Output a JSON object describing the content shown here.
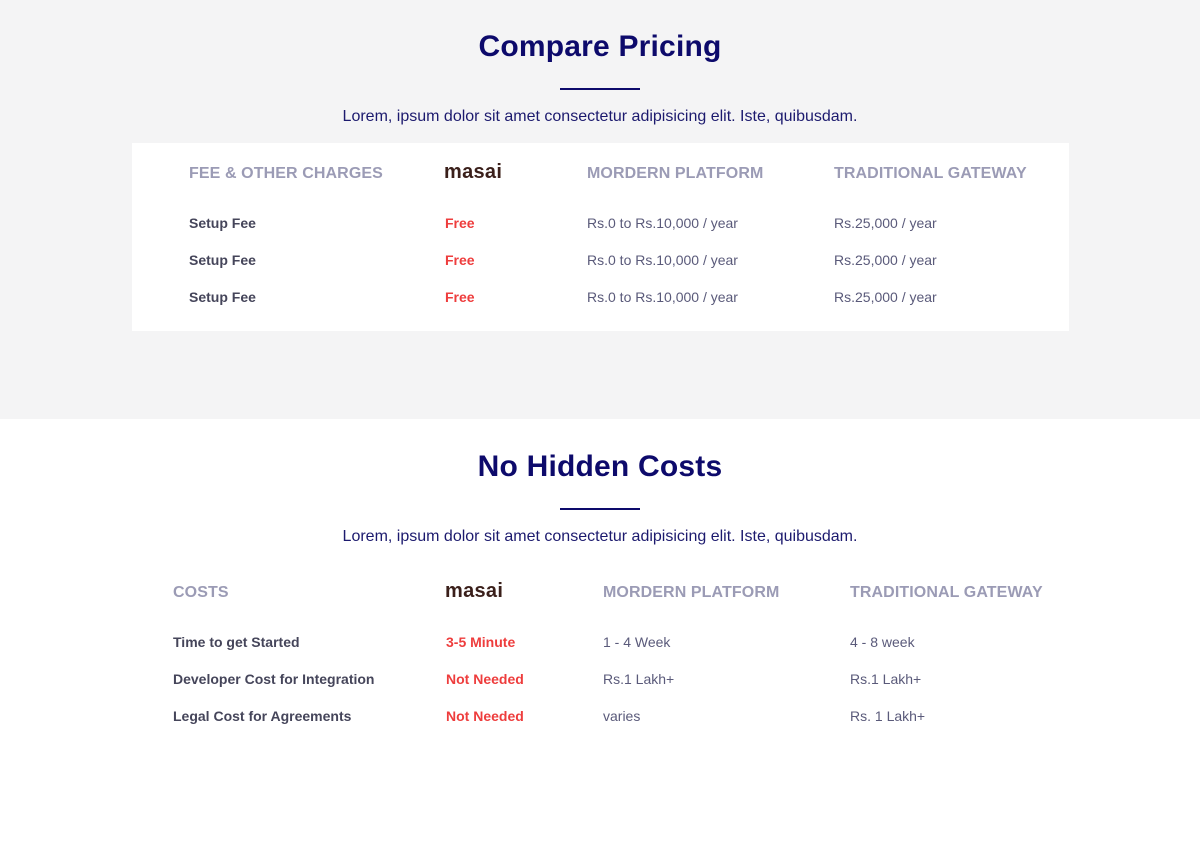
{
  "pricing": {
    "title": "Compare Pricing",
    "subtitle": "Lorem, ipsum dolor sit amet consectetur adipisicing elit. Iste, quibusdam.",
    "headers": {
      "label": "FEE & OTHER CHARGES",
      "brand": "masai",
      "modern": "MORDERN PLATFORM",
      "traditional": "TRADITIONAL GATEWAY"
    },
    "rows": [
      {
        "label": "Setup Fee",
        "brand": "Free",
        "modern": "Rs.0 to Rs.10,000 / year",
        "traditional": "Rs.25,000 / year"
      },
      {
        "label": "Setup Fee",
        "brand": "Free",
        "modern": "Rs.0 to Rs.10,000 / year",
        "traditional": "Rs.25,000 / year"
      },
      {
        "label": "Setup Fee",
        "brand": "Free",
        "modern": "Rs.0 to Rs.10,000 / year",
        "traditional": "Rs.25,000 / year"
      }
    ]
  },
  "costs": {
    "title": "No Hidden Costs",
    "subtitle": "Lorem, ipsum dolor sit amet consectetur adipisicing elit. Iste, quibusdam.",
    "headers": {
      "label": "COSTS",
      "brand": "masai",
      "modern": "MORDERN PLATFORM",
      "traditional": "TRADITIONAL GATEWAY"
    },
    "rows": [
      {
        "label": "Time to get Started",
        "brand": "3-5 Minute",
        "modern": "1 - 4 Week",
        "traditional": "4 - 8 week"
      },
      {
        "label": "Developer Cost for Integration",
        "brand": "Not Needed",
        "modern": "Rs.1 Lakh+",
        "traditional": "Rs.1 Lakh+"
      },
      {
        "label": "Legal Cost for Agreements",
        "brand": "Not Needed",
        "modern": "varies",
        "traditional": "Rs. 1 Lakh+"
      }
    ]
  },
  "colors": {
    "heading": "#0d0a6b",
    "accent": "#ee3d3d",
    "column_header": "#9b9bb5",
    "section_bg": "#f4f4f5"
  }
}
